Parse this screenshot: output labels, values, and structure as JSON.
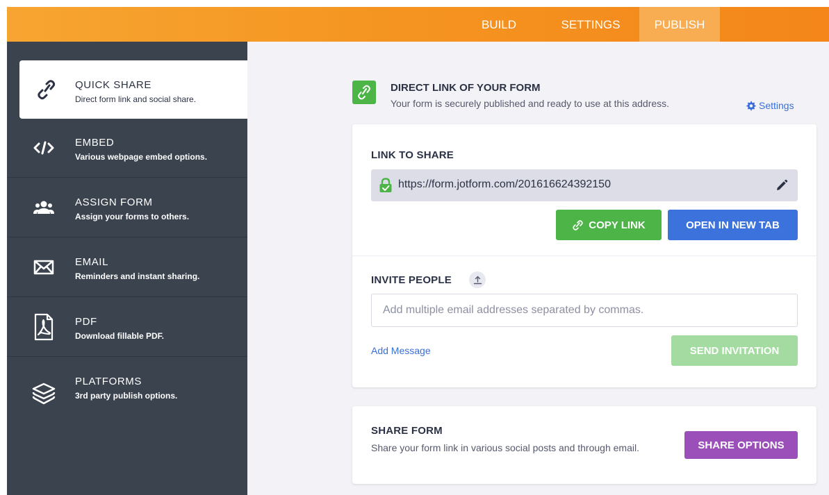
{
  "nav": {
    "build": "BUILD",
    "settings": "SETTINGS",
    "publish": "PUBLISH"
  },
  "sidebar": {
    "items": [
      {
        "title": "QUICK SHARE",
        "desc": "Direct form link and social share.",
        "icon": "link-icon",
        "active": true
      },
      {
        "title": "EMBED",
        "desc": "Various webpage embed options.",
        "icon": "code-icon"
      },
      {
        "title": "ASSIGN FORM",
        "desc": "Assign your forms to others.",
        "icon": "users-icon"
      },
      {
        "title": "EMAIL",
        "desc": "Reminders and instant sharing.",
        "icon": "envelope-icon"
      },
      {
        "title": "PDF",
        "desc": "Download fillable PDF.",
        "icon": "pdf-icon"
      },
      {
        "title": "PLATFORMS",
        "desc": "3rd party publish options.",
        "icon": "layers-icon"
      }
    ]
  },
  "direct_link": {
    "title": "DIRECT LINK OF YOUR FORM",
    "subtitle": "Your form is securely published and ready to use at this address.",
    "settings_link": "Settings"
  },
  "link_card": {
    "label": "LINK TO SHARE",
    "url": "https://form.jotform.com/201616624392150",
    "copy_button": "COPY LINK",
    "open_button": "OPEN IN NEW TAB"
  },
  "invite": {
    "label": "INVITE PEOPLE",
    "placeholder": "Add multiple email addresses separated by commas.",
    "add_message": "Add Message",
    "send_button": "SEND INVITATION"
  },
  "share_form": {
    "title": "SHARE FORM",
    "subtitle": "Share your form link in various social posts and through email.",
    "button": "SHARE OPTIONS"
  },
  "colors": {
    "topbar": "#f59521",
    "sidebar": "#3a434e",
    "green": "#4db548",
    "blue": "#3c72db",
    "purple": "#9b50b9",
    "link": "#3a6fd8"
  }
}
